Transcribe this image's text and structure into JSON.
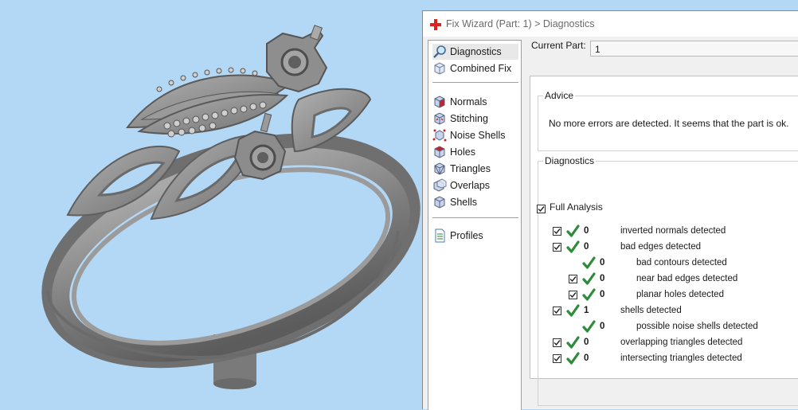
{
  "colors": {
    "viewport_bg": "#b3d8f6",
    "model_gray": "#8f8f8f",
    "check_green": "#2e8b3d",
    "plus_red": "#d9251d"
  },
  "window": {
    "title": "Fix Wizard (Part: 1) > Diagnostics",
    "title_icon": "red-plus-icon"
  },
  "nav": {
    "items": [
      {
        "label": "Diagnostics",
        "icon": "magnifier-icon",
        "selected": true
      },
      {
        "label": "Combined Fix",
        "icon": "cube-icon"
      },
      {
        "label": "Normals",
        "icon": "normals-cube-icon"
      },
      {
        "label": "Stitching",
        "icon": "stitching-cube-icon"
      },
      {
        "label": "Noise Shells",
        "icon": "noise-shells-icon"
      },
      {
        "label": "Holes",
        "icon": "holes-cube-icon"
      },
      {
        "label": "Triangles",
        "icon": "triangles-cube-icon"
      },
      {
        "label": "Overlaps",
        "icon": "overlaps-cube-icon"
      },
      {
        "label": "Shells",
        "icon": "shells-cube-icon"
      },
      {
        "label": "Profiles",
        "icon": "document-icon"
      }
    ]
  },
  "current_part": {
    "label": "Current Part:",
    "value": "1"
  },
  "advice": {
    "legend": "Advice",
    "text": "No more errors are detected. It seems that the part is ok."
  },
  "diagnostics": {
    "legend": "Diagnostics",
    "full_analysis": {
      "label": "Full Analysis",
      "checked": true
    },
    "rows": [
      {
        "count": "0",
        "text": "inverted normals detected",
        "has_checkbox": true,
        "indent": 0
      },
      {
        "count": "0",
        "text": "bad edges detected",
        "has_checkbox": true,
        "indent": 0
      },
      {
        "count": "0",
        "text": "bad contours detected",
        "has_checkbox": false,
        "indent": 1
      },
      {
        "count": "0",
        "text": "near bad edges detected",
        "has_checkbox": true,
        "indent": 1
      },
      {
        "count": "0",
        "text": "planar holes detected",
        "has_checkbox": true,
        "indent": 1
      },
      {
        "count": "1",
        "text": "shells detected",
        "has_checkbox": true,
        "indent": 0
      },
      {
        "count": "0",
        "text": "possible noise shells detected",
        "has_checkbox": false,
        "indent": 1
      },
      {
        "count": "0",
        "text": "overlapping triangles detected",
        "has_checkbox": true,
        "indent": 0
      },
      {
        "count": "0",
        "text": "intersecting triangles detected",
        "has_checkbox": true,
        "indent": 0
      }
    ]
  }
}
